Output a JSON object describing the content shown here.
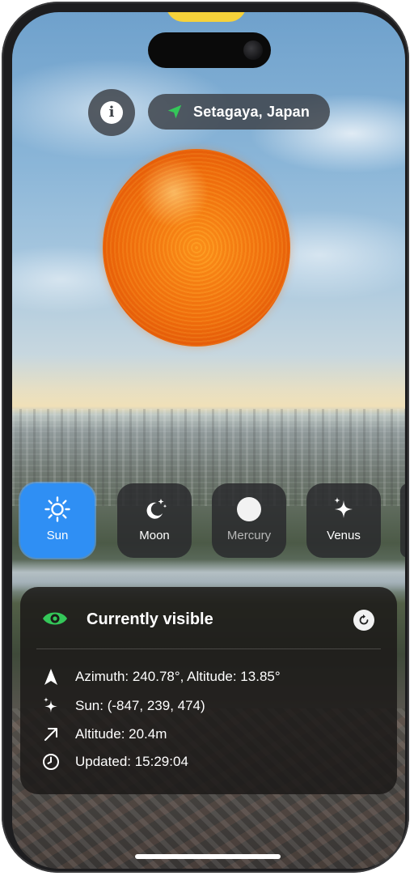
{
  "location": {
    "name": "Setagaya, Japan",
    "icon": "location-arrow-icon"
  },
  "info_button": {
    "icon": "info-icon",
    "glyph": "i"
  },
  "bodies": [
    {
      "label": "Sun",
      "icon": "sun-icon",
      "selected": true
    },
    {
      "label": "Moon",
      "icon": "moon-stars-icon",
      "selected": false
    },
    {
      "label": "Mercury",
      "icon": "planet-circle-icon",
      "selected": false
    },
    {
      "label": "Venus",
      "icon": "sparkle-icon",
      "selected": false
    }
  ],
  "status": {
    "title": "Currently visible",
    "title_icon": "eye-icon",
    "action_icon": "refresh-icon",
    "accent_color": "#34c759"
  },
  "details": {
    "azimuth_altitude": "Azimuth: 240.78°, Altitude: 13.85°",
    "position": "Sun: (-847, 239, 474)",
    "altitude_m": "Altitude: 20.4m",
    "updated": "Updated: 15:29:04"
  },
  "colors": {
    "selected_tile": "#2f8ff4",
    "location_arrow": "#34c759"
  }
}
